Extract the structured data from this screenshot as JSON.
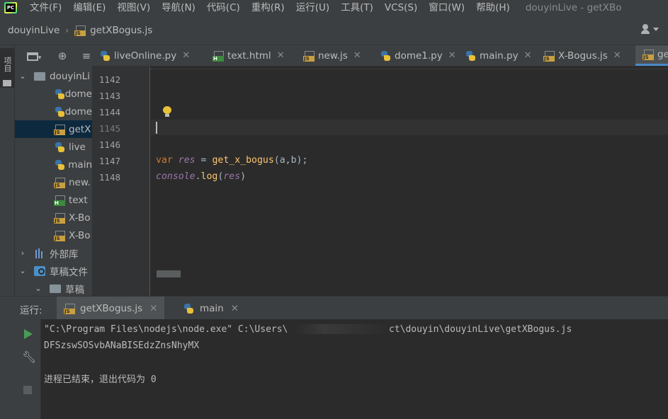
{
  "menubar": {
    "logo_text": "PC",
    "items": [
      "文件(F)",
      "编辑(E)",
      "视图(V)",
      "导航(N)",
      "代码(C)",
      "重构(R)",
      "运行(U)",
      "工具(T)",
      "VCS(S)",
      "窗口(W)",
      "帮助(H)"
    ],
    "window_title": "douyinLive - getXBo"
  },
  "navbar": {
    "project": "douyinLive",
    "file": "getXBogus.js"
  },
  "left_stripe": {
    "project_label": "项目"
  },
  "project_tree": {
    "root": "douyinLi",
    "files": [
      {
        "name": "dome",
        "type": "py"
      },
      {
        "name": "dome",
        "type": "py"
      },
      {
        "name": "getX",
        "type": "js"
      },
      {
        "name": "live",
        "type": "py"
      },
      {
        "name": "main",
        "type": "py"
      },
      {
        "name": "new.",
        "type": "js"
      },
      {
        "name": "text",
        "type": "html"
      },
      {
        "name": "X-Bo",
        "type": "js"
      },
      {
        "name": "X-Bo",
        "type": "js"
      }
    ],
    "external_libs": "外部库",
    "scratches": "草稿文件",
    "scratches_child": "草稿"
  },
  "tabs": [
    {
      "name": "liveOnline.py",
      "type": "py"
    },
    {
      "name": "text.html",
      "type": "html"
    },
    {
      "name": "new.js",
      "type": "js"
    },
    {
      "name": "dome1.py",
      "type": "py"
    },
    {
      "name": "main.py",
      "type": "py"
    },
    {
      "name": "X-Bogus.js",
      "type": "js"
    },
    {
      "name": "ge",
      "type": "js"
    }
  ],
  "editor": {
    "line_numbers": [
      "1142",
      "1143",
      "1144",
      "1145",
      "1146",
      "1147",
      "1148"
    ],
    "code_line_1147": {
      "kw": "var",
      "var": "res",
      "eq": " = ",
      "fn": "get_x_bogus",
      "args": "(a,b);"
    },
    "code_line_1148": {
      "obj": "console",
      "dot": ".",
      "method": "log",
      "open": "(",
      "arg": "res",
      "close": ")"
    }
  },
  "run_panel": {
    "label": "运行:",
    "tabs": [
      {
        "name": "getXBogus.js",
        "type": "js"
      },
      {
        "name": "main",
        "type": "py"
      }
    ],
    "console_lines": [
      "\"C:\\Program Files\\nodejs\\node.exe\" C:\\Users\\",
      "ct\\douyin\\douyinLive\\getXBogus.js",
      "DFSzswSOSvbANaBISEdzZnsNhyMX",
      "进程已结束，退出代码为 0"
    ]
  },
  "colors": {
    "background": "#2b2b2b",
    "panel": "#3c3f41",
    "selection": "#0d293e",
    "keyword": "#cc7832",
    "function": "#ffc66d",
    "variable": "#9876aa",
    "run_green": "#499c54"
  }
}
